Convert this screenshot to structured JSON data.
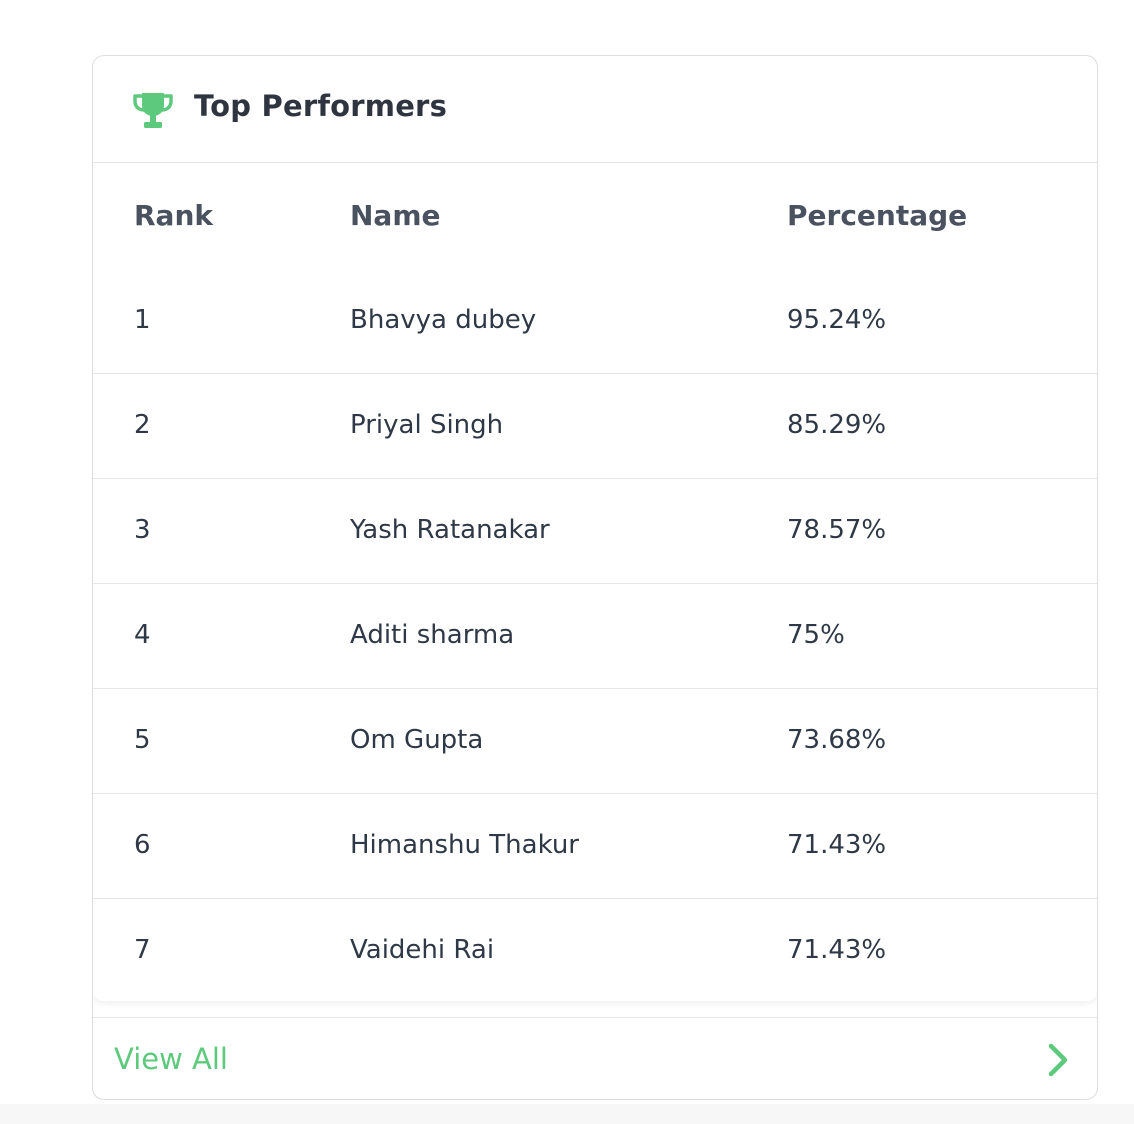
{
  "card": {
    "title": "Top Performers",
    "icon": "trophy-icon",
    "accent_color": "#5dc97c"
  },
  "table": {
    "headers": {
      "rank": "Rank",
      "name": "Name",
      "percentage": "Percentage"
    },
    "rows": [
      {
        "rank": "1",
        "name": "Bhavya dubey",
        "percentage": "95.24%"
      },
      {
        "rank": "2",
        "name": "Priyal Singh",
        "percentage": "85.29%"
      },
      {
        "rank": "3",
        "name": "Yash Ratanakar",
        "percentage": "78.57%"
      },
      {
        "rank": "4",
        "name": "Aditi sharma",
        "percentage": "75%"
      },
      {
        "rank": "5",
        "name": "Om Gupta",
        "percentage": "73.68%"
      },
      {
        "rank": "6",
        "name": "Himanshu Thakur",
        "percentage": "71.43%"
      },
      {
        "rank": "7",
        "name": "Vaidehi Rai",
        "percentage": "71.43%"
      }
    ]
  },
  "footer": {
    "view_all_label": "View All",
    "icon": "chevron-right-icon"
  }
}
